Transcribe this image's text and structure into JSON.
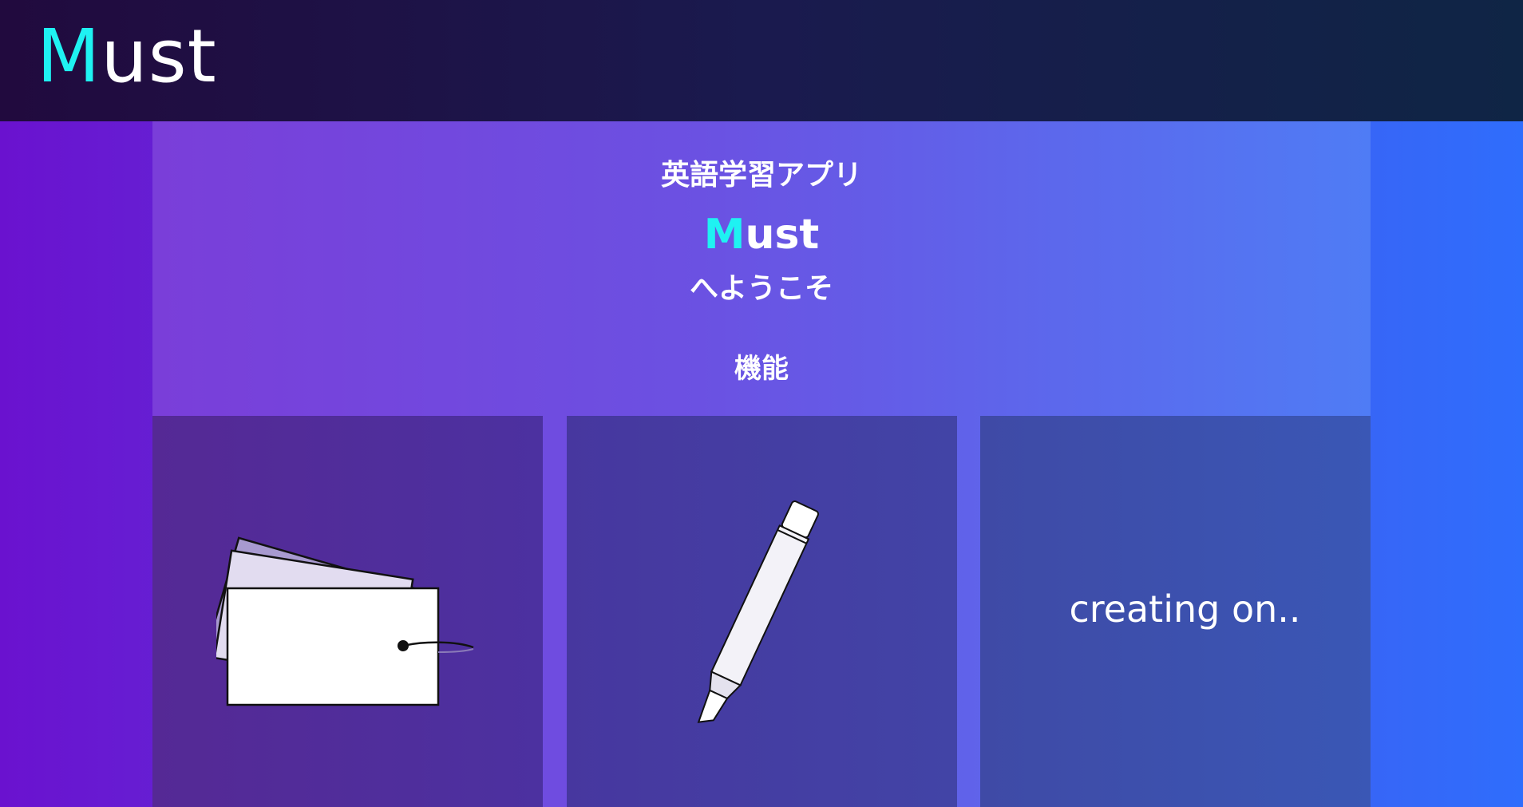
{
  "header": {
    "logo_accent": "M",
    "logo_rest": "ust"
  },
  "intro": {
    "subtitle": "英語学習アプリ",
    "app_accent": "M",
    "app_rest": "ust",
    "welcome": "へようこそ",
    "features_heading": "機能"
  },
  "features": [
    {
      "icon": "flashcards-icon"
    },
    {
      "icon": "marker-pen-icon"
    },
    {
      "status": "creating on.."
    }
  ],
  "colors": {
    "accent": "#1ff2f2",
    "topbar": "#1a1a4e",
    "text": "#ffffff"
  }
}
